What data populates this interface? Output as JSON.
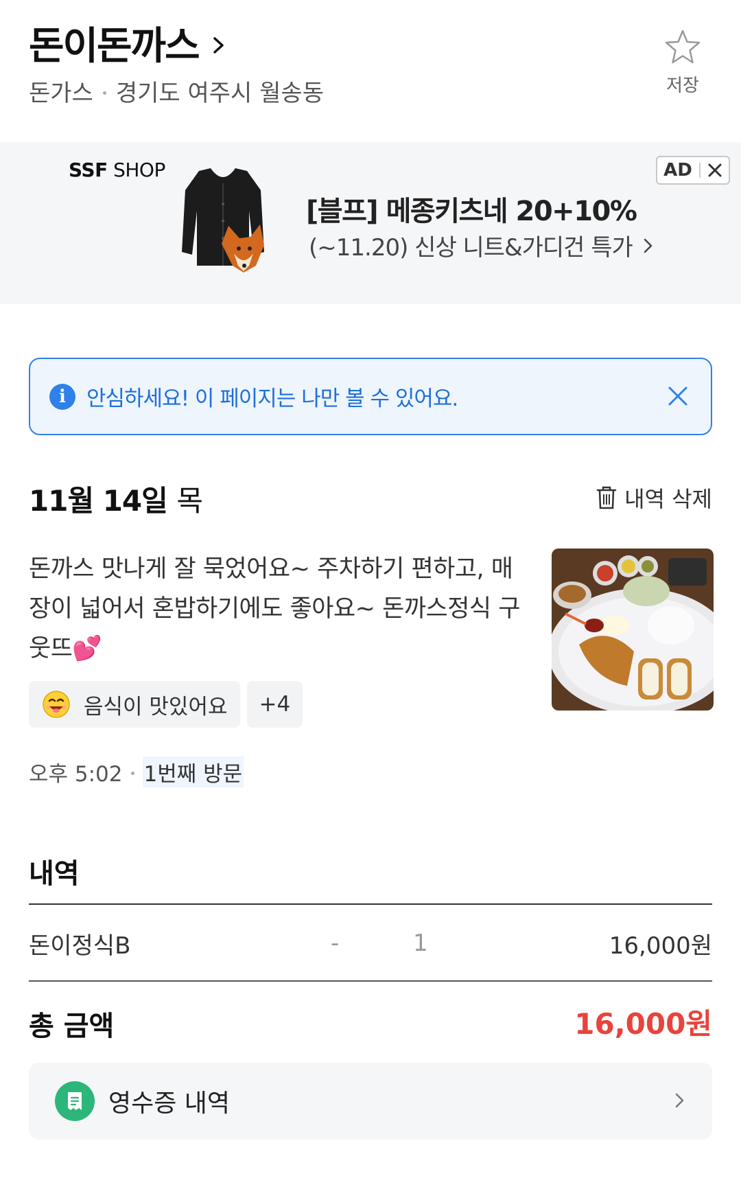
{
  "header": {
    "store_name": "돈이돈까스",
    "category": "돈가스",
    "location": "경기도 여주시 월송동",
    "save_label": "저장"
  },
  "ad": {
    "brand_bold": "SSF",
    "brand_rest": " SHOP",
    "title": "[블프] 메종키츠네 20+10%",
    "description": "(~11.20) 신상 니트&가디건 특가",
    "badge_label": "AD"
  },
  "notice": {
    "text": "안심하세요! 이 페이지는 나만 볼 수 있어요."
  },
  "visit": {
    "date": "11월 14일",
    "day_of_week": "목",
    "delete_label": "내역 삭제",
    "review_text": "돈까스 맛나게 잘 묵었어요~ 주차하기 편하고, 매장이 넓어서 혼밥하기에도 좋아요~ 돈까스정식 구웃뜨",
    "review_emoji": "💕",
    "tags": [
      {
        "label": "음식이 맛있어요",
        "icon": "smiley-icon"
      },
      {
        "label": "+4"
      }
    ],
    "time": "오후 5:02",
    "visit_count": "1번째 방문"
  },
  "order": {
    "section_title": "내역",
    "items": [
      {
        "name": "돈이정식B",
        "option": "-",
        "quantity": "1",
        "price": "16,000원"
      }
    ],
    "total_label": "총 금액",
    "total_amount": "16,000원"
  },
  "receipt": {
    "label": "영수증 내역"
  },
  "colors": {
    "accent_blue": "#2f80e8",
    "total_red": "#e8433c",
    "receipt_green": "#2db67a"
  }
}
